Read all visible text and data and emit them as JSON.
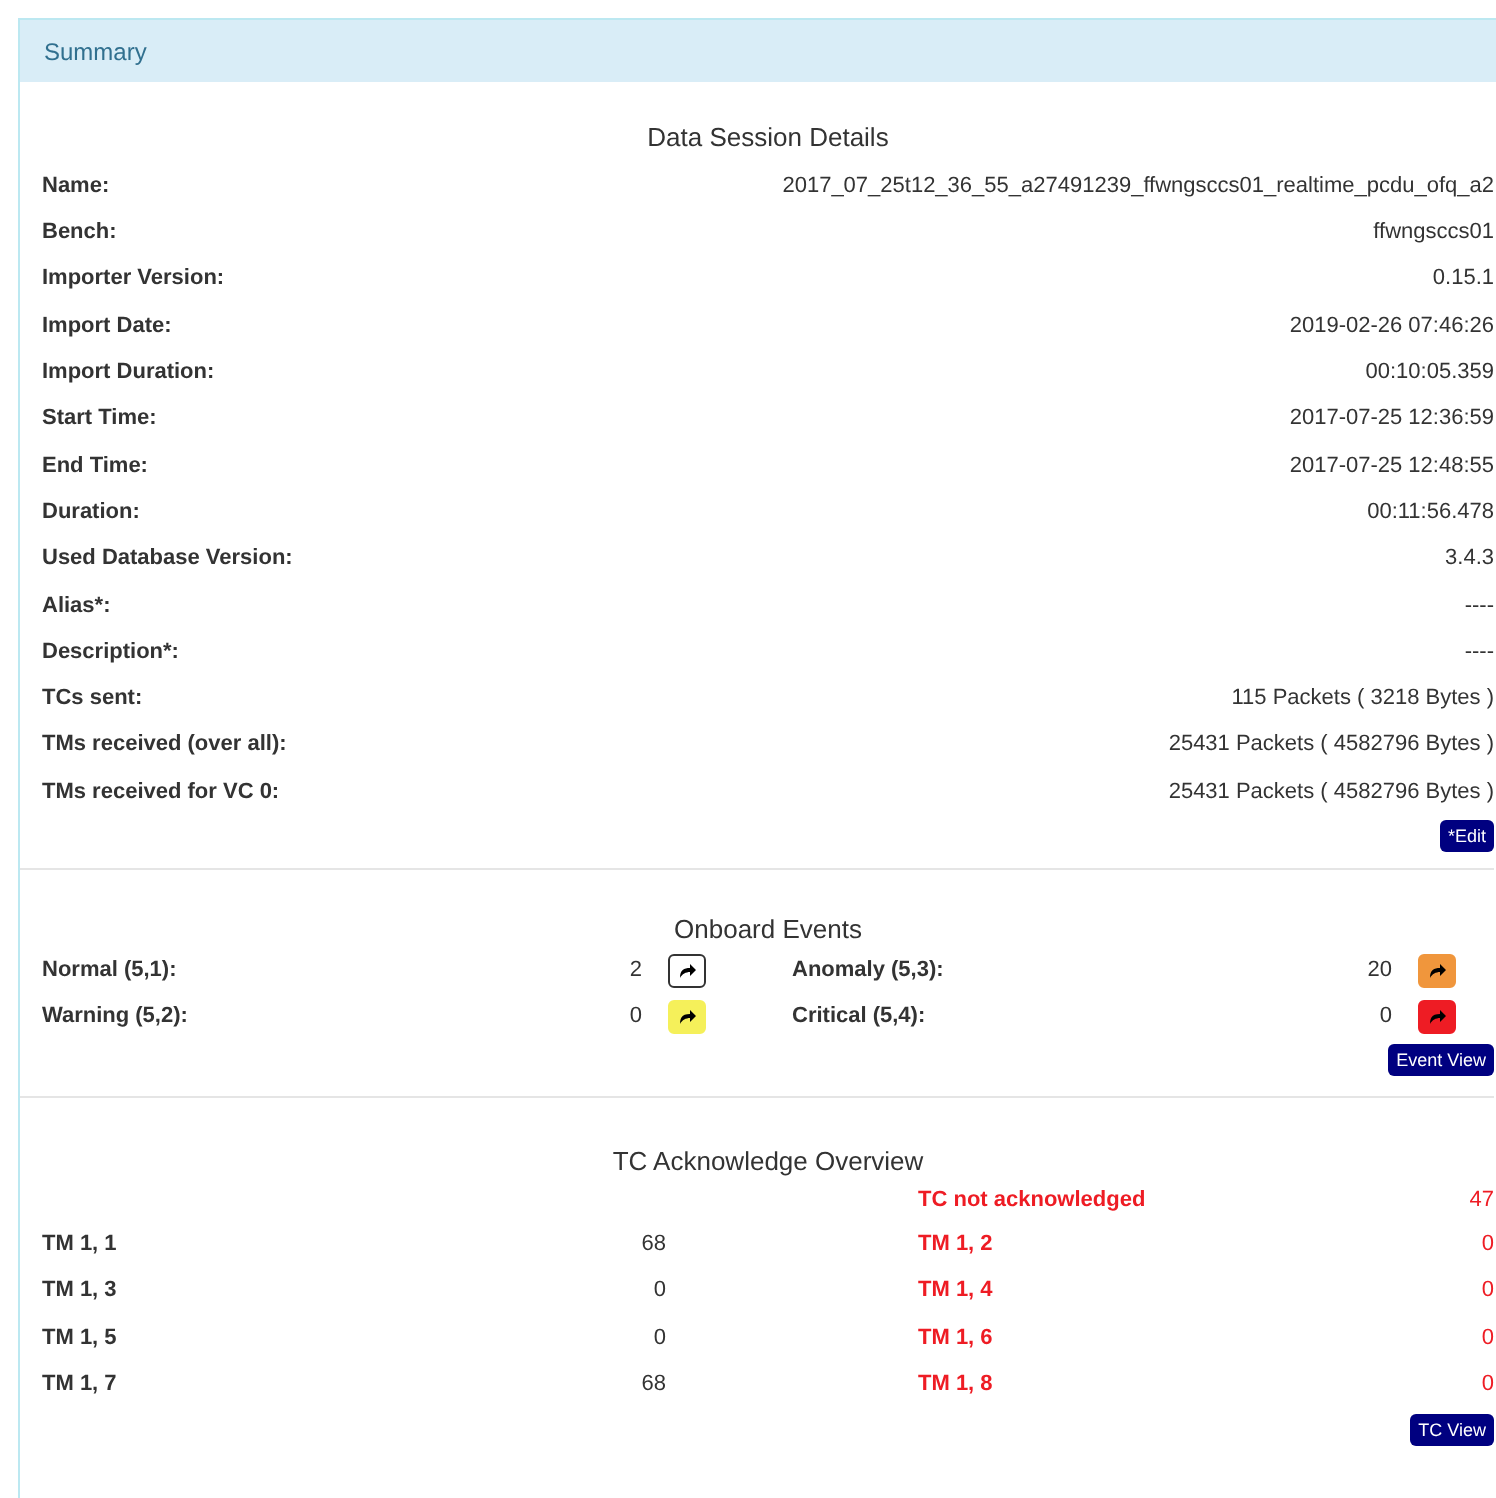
{
  "panel": {
    "title": "Summary"
  },
  "details": {
    "title": "Data Session Details",
    "rows": [
      {
        "label": "Name:",
        "value": "2017_07_25t12_36_55_a27491239_ffwngsccs01_realtime_pcdu_ofq_a2"
      },
      {
        "label": "Bench:",
        "value": "ffwngsccs01"
      },
      {
        "label": "Importer Version:",
        "value": "0.15.1"
      },
      {
        "label": "Import Date:",
        "value": "2019-02-26 07:46:26"
      },
      {
        "label": "Import Duration:",
        "value": "00:10:05.359"
      },
      {
        "label": "Start Time:",
        "value": "2017-07-25 12:36:59"
      },
      {
        "label": "End Time:",
        "value": "2017-07-25 12:48:55"
      },
      {
        "label": "Duration:",
        "value": "00:11:56.478"
      },
      {
        "label": "Used Database Version:",
        "value": "3.4.3"
      },
      {
        "label": "Alias*:",
        "value": "----"
      },
      {
        "label": "Description*:",
        "value": "----"
      },
      {
        "label": "TCs sent:",
        "value": "115 Packets ( 3218 Bytes )"
      },
      {
        "label": "TMs received (over all):",
        "value": "25431 Packets ( 4582796 Bytes )"
      },
      {
        "label": "TMs received for VC 0:",
        "value": "25431 Packets ( 4582796 Bytes )"
      }
    ],
    "button": "*Edit"
  },
  "events": {
    "title": "Onboard Events",
    "items": [
      {
        "label": "Normal (5,1):",
        "count": "2",
        "color": "#ffffff"
      },
      {
        "label": "Anomaly (5,3):",
        "count": "20",
        "color": "#f0963c"
      },
      {
        "label": "Warning (5,2):",
        "count": "0",
        "color": "#f5f05a"
      },
      {
        "label": "Critical (5,4):",
        "count": "0",
        "color": "#ee1c24"
      }
    ],
    "button": "Event View"
  },
  "tc_ack": {
    "title": "TC Acknowledge Overview",
    "header": {
      "label": "TC not acknowledged",
      "value": "47"
    },
    "rows": [
      {
        "label": "TM 1, 1",
        "value": "68",
        "label_2": "TM 1, 2",
        "value_2": "0"
      },
      {
        "label": "TM 1, 3",
        "value": "0",
        "label_2": "TM 1, 4",
        "value_2": "0"
      },
      {
        "label": "TM 1, 5",
        "value": "0",
        "label_2": "TM 1, 6",
        "value_2": "0"
      },
      {
        "label": "TM 1, 7",
        "value": "68",
        "label_2": "TM 1, 8",
        "value_2": "0"
      }
    ],
    "button": "TC View"
  }
}
